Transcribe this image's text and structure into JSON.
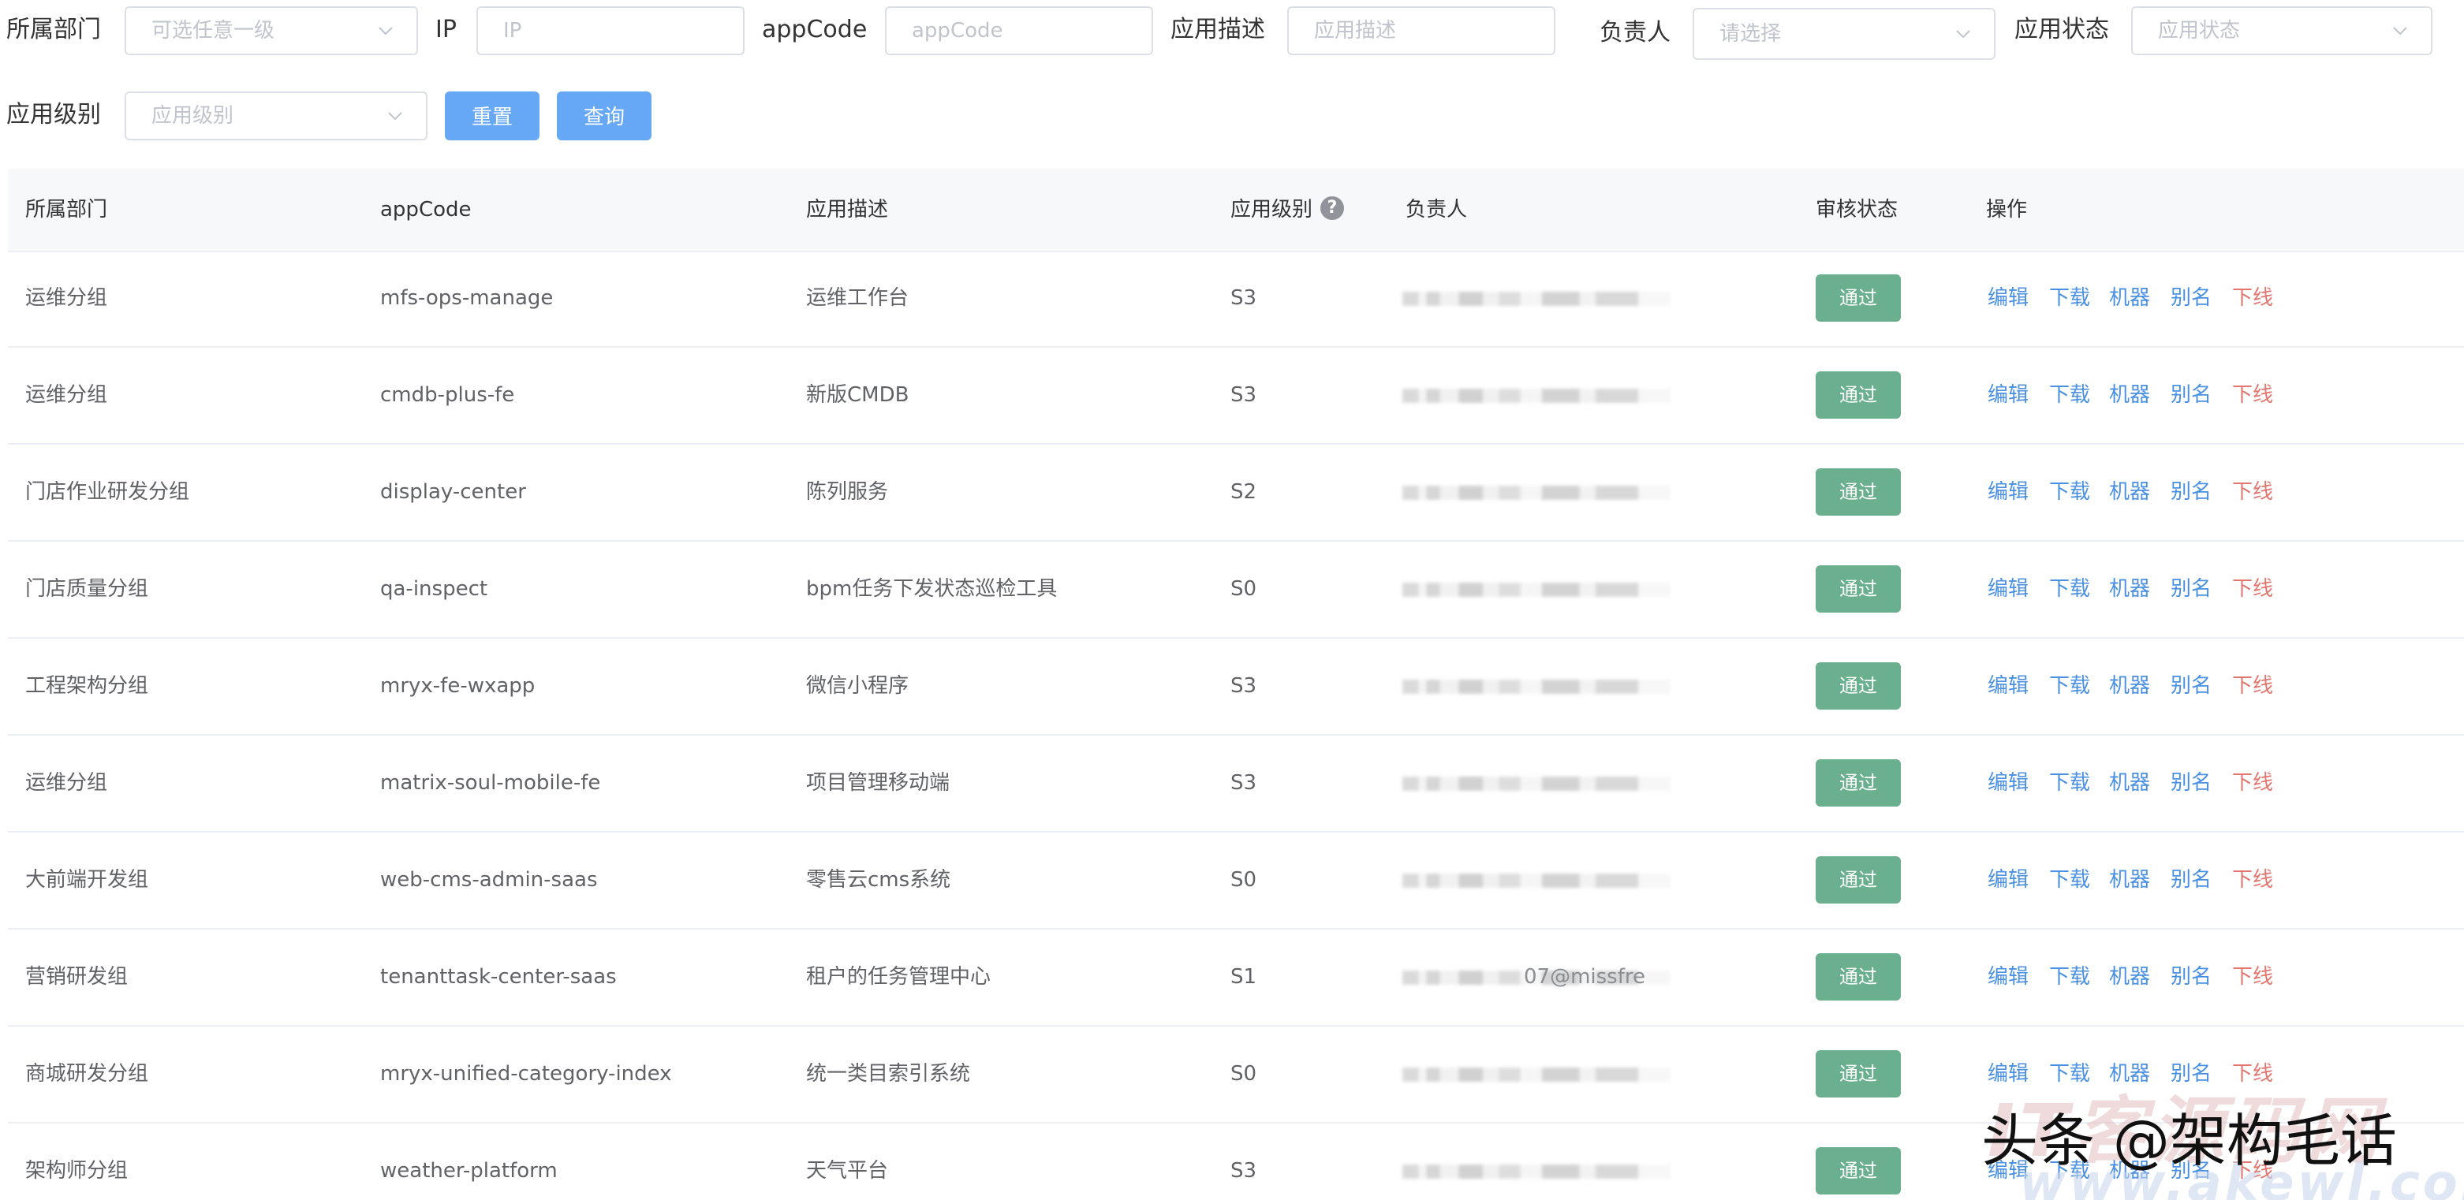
{
  "filters": {
    "department_label": "所属部门",
    "department_placeholder": "可选任意一级",
    "ip_label": "IP",
    "ip_placeholder": "IP",
    "appcode_label": "appCode",
    "appcode_placeholder": "appCode",
    "desc_label": "应用描述",
    "desc_placeholder": "应用描述",
    "owner_label": "负责人",
    "owner_placeholder": "请选择",
    "status_label": "应用状态",
    "status_placeholder": "应用状态",
    "level_label": "应用级别",
    "level_placeholder": "应用级别",
    "reset_label": "重置",
    "query_label": "查询"
  },
  "table": {
    "headers": {
      "department": "所属部门",
      "appcode": "appCode",
      "desc": "应用描述",
      "level": "应用级别",
      "owner": "负责人",
      "review": "审核状态",
      "actions": "操作"
    },
    "help_glyph": "?",
    "rows": [
      {
        "department": "运维分组",
        "appcode": "mfs-ops-manage",
        "desc": "运维工作台",
        "level": "S3",
        "owner_visible": "",
        "review": "通过"
      },
      {
        "department": "运维分组",
        "appcode": "cmdb-plus-fe",
        "desc": "新版CMDB",
        "level": "S3",
        "owner_visible": "",
        "review": "通过"
      },
      {
        "department": "门店作业研发分组",
        "appcode": "display-center",
        "desc": "陈列服务",
        "level": "S2",
        "owner_visible": "",
        "review": "通过"
      },
      {
        "department": "门店质量分组",
        "appcode": "qa-inspect",
        "desc": "bpm任务下发状态巡检工具",
        "level": "S0",
        "owner_visible": "",
        "review": "通过"
      },
      {
        "department": "工程架构分组",
        "appcode": "mryx-fe-wxapp",
        "desc": "微信小程序",
        "level": "S3",
        "owner_visible": "",
        "review": "通过"
      },
      {
        "department": "运维分组",
        "appcode": "matrix-soul-mobile-fe",
        "desc": "项目管理移动端",
        "level": "S3",
        "owner_visible": "",
        "review": "通过"
      },
      {
        "department": "大前端开发组",
        "appcode": "web-cms-admin-saas",
        "desc": "零售云cms系统",
        "level": "S0",
        "owner_visible": "",
        "review": "通过"
      },
      {
        "department": "营销研发组",
        "appcode": "tenanttask-center-saas",
        "desc": "租户的任务管理中心",
        "level": "S1",
        "owner_visible": "07@missfre",
        "review": "通过"
      },
      {
        "department": "商城研发分组",
        "appcode": "mryx-unified-category-index",
        "desc": "统一类目索引系统",
        "level": "S0",
        "owner_visible": "",
        "review": "通过"
      },
      {
        "department": "架构师分组",
        "appcode": "weather-platform",
        "desc": "天气平台",
        "level": "S3",
        "owner_visible": "",
        "review": "通过"
      }
    ],
    "actions": {
      "edit": "编辑",
      "download": "下载",
      "machine": "机器",
      "alias": "别名",
      "offline": "下线"
    }
  },
  "watermark": {
    "back_text": "IT客源码网",
    "url_text": "www.akewl.com",
    "front_text": "头条 @架构毛话"
  },
  "colors": {
    "primary_button": "#66a8f5",
    "link": "#4a90e2",
    "danger_link": "#e2766f",
    "approved_badge": "#6aaf8e",
    "header_bg": "#f7f8fa"
  },
  "icons": {
    "select_arrow": "chevron-down-icon",
    "level_help": "question-circle-icon"
  }
}
